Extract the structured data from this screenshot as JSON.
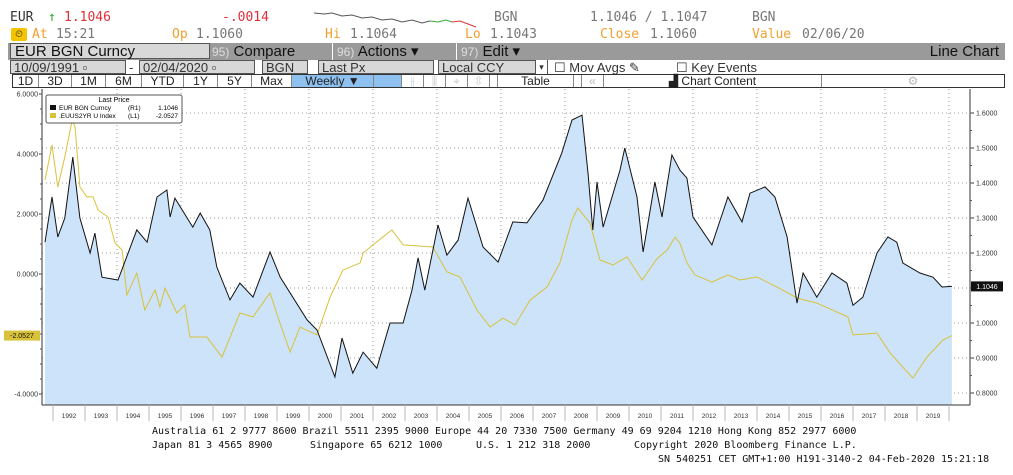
{
  "quote": {
    "ticker": "EUR",
    "arrow": "↑",
    "last": "1.1046",
    "change": "-.0014",
    "currency_left": "BGN",
    "bid_ask": "1.1046 / 1.1047",
    "currency_right": "BGN",
    "at_label": "At",
    "at_value": "15:21",
    "op_label": "Op",
    "op_value": "1.1060",
    "hi_label": "Hi",
    "hi_value": "1.1064",
    "lo_label": "Lo",
    "lo_value": "1.1043",
    "close_label": "Close",
    "close_value": "1.1060",
    "value_label": "Value",
    "value_value": "02/06/20"
  },
  "toolbar": {
    "security": "EUR BGN Curncy",
    "compare_num": "95)",
    "compare": "Compare",
    "actions_num": "96)",
    "actions": "Actions ▾",
    "edit_num": "97)",
    "edit": "Edit ▾",
    "chart_type": "Line Chart"
  },
  "settings": {
    "start_date": "10/09/1991",
    "end_date": "02/04/2020",
    "currency": "BGN",
    "field": "Last Px",
    "ccy_mode": "Local CCY",
    "mov_avgs": "Mov Avgs",
    "key_events": "Key Events"
  },
  "periods": [
    "1D",
    "3D",
    "1M",
    "6M",
    "YTD",
    "1Y",
    "5Y",
    "Max"
  ],
  "frequency": "Weekly ▼",
  "table_label": "Table",
  "chart_content_label": "Chart Content",
  "colors": {
    "black_series": "#111111",
    "yellow_series": "#d8c23a",
    "fill": "#cce3fa",
    "selected": "#8ec1f0",
    "red": "#e0303a",
    "orange": "#f0a030"
  },
  "chart_data": {
    "type": "line",
    "legend": {
      "title": "Last Price",
      "position": "top-left",
      "entries": [
        {
          "name": "EUR BGN Curncy",
          "axis": "(R1)",
          "last": "1.1046"
        },
        {
          "name": ".EUUS2YR U Index",
          "axis": "(L1)",
          "last": "-2.0527"
        }
      ]
    },
    "x_ticks": [
      "1992",
      "1993",
      "1994",
      "1995",
      "1996",
      "1997",
      "1998",
      "1999",
      "2000",
      "2001",
      "2002",
      "2003",
      "2004",
      "2005",
      "2006",
      "2007",
      "2008",
      "2009",
      "2010",
      "2011",
      "2012",
      "2013",
      "2014",
      "2015",
      "2016",
      "2017",
      "2018",
      "2019"
    ],
    "xlim": [
      1991.7,
      2020.1
    ],
    "left_axis": {
      "ylim": [
        -4.2,
        6.0
      ],
      "ticks": [
        "6.0000",
        "4.0000",
        "2.0000",
        "0.0000",
        "-4.0000"
      ],
      "tick_values": [
        6,
        4,
        2,
        0,
        -4
      ],
      "last_label": "-2.0527",
      "last_value": -2.0527
    },
    "right_axis": {
      "ylim": [
        0.77,
        1.655
      ],
      "ticks": [
        "1.6000",
        "1.5000",
        "1.4000",
        "1.3000",
        "1.2000",
        "1.0000",
        "0.9000",
        "0.8000"
      ],
      "tick_values": [
        1.6,
        1.5,
        1.4,
        1.3,
        1.2,
        1.0,
        0.9,
        0.8
      ],
      "last_label": "1.1046",
      "last_value": 1.1046
    },
    "grid": true,
    "series": [
      {
        "name": "EUR BGN Curncy",
        "axis": "right",
        "filled": true,
        "points": [
          [
            1991.75,
            1.231
          ],
          [
            1991.97,
            1.36
          ],
          [
            1992.15,
            1.246
          ],
          [
            1992.37,
            1.3
          ],
          [
            1992.62,
            1.474
          ],
          [
            1992.84,
            1.3
          ],
          [
            1993.16,
            1.2
          ],
          [
            1993.31,
            1.257
          ],
          [
            1993.53,
            1.131
          ],
          [
            1994.03,
            1.123
          ],
          [
            1994.62,
            1.266
          ],
          [
            1994.94,
            1.231
          ],
          [
            1995.25,
            1.36
          ],
          [
            1995.56,
            1.38
          ],
          [
            1995.66,
            1.303
          ],
          [
            1995.81,
            1.357
          ],
          [
            1996.37,
            1.274
          ],
          [
            1996.6,
            1.314
          ],
          [
            1996.9,
            1.266
          ],
          [
            1997.12,
            1.16
          ],
          [
            1997.53,
            1.066
          ],
          [
            1997.84,
            1.114
          ],
          [
            1998.25,
            1.074
          ],
          [
            1998.78,
            1.203
          ],
          [
            1999.1,
            1.131
          ],
          [
            1999.94,
            1.009
          ],
          [
            2000.25,
            0.98
          ],
          [
            2000.81,
            0.846
          ],
          [
            2001.03,
            0.957
          ],
          [
            2001.37,
            0.857
          ],
          [
            2001.69,
            0.917
          ],
          [
            2002.12,
            0.871
          ],
          [
            2002.53,
            1.0
          ],
          [
            2002.94,
            1.0
          ],
          [
            2003.22,
            1.094
          ],
          [
            2003.41,
            1.186
          ],
          [
            2003.62,
            1.094
          ],
          [
            2004.03,
            1.28
          ],
          [
            2004.31,
            1.194
          ],
          [
            2004.66,
            1.237
          ],
          [
            2004.97,
            1.357
          ],
          [
            2005.44,
            1.217
          ],
          [
            2005.91,
            1.174
          ],
          [
            2006.37,
            1.289
          ],
          [
            2006.81,
            1.286
          ],
          [
            2007.31,
            1.351
          ],
          [
            2007.9,
            1.486
          ],
          [
            2008.22,
            1.58
          ],
          [
            2008.53,
            1.594
          ],
          [
            2008.72,
            1.429
          ],
          [
            2008.87,
            1.266
          ],
          [
            2009.0,
            1.403
          ],
          [
            2009.19,
            1.274
          ],
          [
            2009.72,
            1.437
          ],
          [
            2009.87,
            1.5
          ],
          [
            2010.25,
            1.36
          ],
          [
            2010.44,
            1.203
          ],
          [
            2010.81,
            1.403
          ],
          [
            2011.03,
            1.303
          ],
          [
            2011.34,
            1.48
          ],
          [
            2011.59,
            1.437
          ],
          [
            2011.81,
            1.414
          ],
          [
            2012.0,
            1.303
          ],
          [
            2012.59,
            1.223
          ],
          [
            2013.09,
            1.36
          ],
          [
            2013.53,
            1.289
          ],
          [
            2013.78,
            1.371
          ],
          [
            2014.25,
            1.389
          ],
          [
            2014.56,
            1.36
          ],
          [
            2014.94,
            1.246
          ],
          [
            2015.25,
            1.057
          ],
          [
            2015.44,
            1.143
          ],
          [
            2015.87,
            1.074
          ],
          [
            2016.34,
            1.143
          ],
          [
            2016.81,
            1.114
          ],
          [
            2017.0,
            1.051
          ],
          [
            2017.31,
            1.074
          ],
          [
            2017.75,
            1.2
          ],
          [
            2018.09,
            1.246
          ],
          [
            2018.37,
            1.231
          ],
          [
            2018.56,
            1.171
          ],
          [
            2019.09,
            1.143
          ],
          [
            2019.5,
            1.131
          ],
          [
            2019.78,
            1.103
          ],
          [
            2020.09,
            1.1046
          ]
        ]
      },
      {
        "name": ".EUUS2YR U Index",
        "axis": "left",
        "filled": false,
        "points": [
          [
            1991.75,
            3.13
          ],
          [
            1991.97,
            4.3
          ],
          [
            1992.15,
            2.9
          ],
          [
            1992.37,
            3.9
          ],
          [
            1992.6,
            5.13
          ],
          [
            1992.69,
            4.9
          ],
          [
            1992.84,
            2.9
          ],
          [
            1993.06,
            2.57
          ],
          [
            1993.25,
            2.57
          ],
          [
            1993.41,
            2.13
          ],
          [
            1993.72,
            1.9
          ],
          [
            1993.94,
            1.03
          ],
          [
            1994.16,
            0.8
          ],
          [
            1994.31,
            -0.7
          ],
          [
            1994.62,
            0.03
          ],
          [
            1994.87,
            -1.2
          ],
          [
            1995.19,
            -0.53
          ],
          [
            1995.34,
            -1.1
          ],
          [
            1995.5,
            -0.47
          ],
          [
            1995.87,
            -1.3
          ],
          [
            1996.12,
            -1.03
          ],
          [
            1996.28,
            -2.1
          ],
          [
            1996.81,
            -2.1
          ],
          [
            1997.28,
            -2.77
          ],
          [
            1997.84,
            -1.3
          ],
          [
            1998.25,
            -1.43
          ],
          [
            1998.78,
            -0.63
          ],
          [
            1999.09,
            -1.63
          ],
          [
            1999.41,
            -2.6
          ],
          [
            1999.72,
            -1.77
          ],
          [
            2000.25,
            -2.03
          ],
          [
            2000.66,
            -0.77
          ],
          [
            2001.06,
            0.13
          ],
          [
            2001.6,
            0.37
          ],
          [
            2001.69,
            0.7
          ],
          [
            2002.0,
            0.97
          ],
          [
            2002.59,
            1.47
          ],
          [
            2002.94,
            0.97
          ],
          [
            2003.87,
            0.9
          ],
          [
            2004.31,
            0.07
          ],
          [
            2004.72,
            -0.1
          ],
          [
            2005.25,
            -1.2
          ],
          [
            2005.66,
            -1.77
          ],
          [
            2006.06,
            -1.47
          ],
          [
            2006.44,
            -1.7
          ],
          [
            2006.91,
            -0.87
          ],
          [
            2007.44,
            -0.43
          ],
          [
            2007.84,
            0.37
          ],
          [
            2008.22,
            1.8
          ],
          [
            2008.4,
            2.2
          ],
          [
            2008.78,
            1.7
          ],
          [
            2009.09,
            0.47
          ],
          [
            2009.5,
            0.3
          ],
          [
            2009.94,
            0.57
          ],
          [
            2010.41,
            -0.2
          ],
          [
            2010.87,
            0.5
          ],
          [
            2011.19,
            0.8
          ],
          [
            2011.44,
            1.23
          ],
          [
            2011.59,
            1.03
          ],
          [
            2011.81,
            0.37
          ],
          [
            2012.06,
            -0.03
          ],
          [
            2012.59,
            -0.27
          ],
          [
            2013.09,
            -0.03
          ],
          [
            2013.47,
            -0.2
          ],
          [
            2014.0,
            -0.1
          ],
          [
            2014.62,
            -0.43
          ],
          [
            2015.25,
            -0.8
          ],
          [
            2015.87,
            -0.97
          ],
          [
            2016.84,
            -1.43
          ],
          [
            2017.0,
            -2.03
          ],
          [
            2017.75,
            -1.97
          ],
          [
            2018.16,
            -2.63
          ],
          [
            2018.87,
            -3.47
          ],
          [
            2019.31,
            -2.77
          ],
          [
            2019.81,
            -2.2
          ],
          [
            2020.09,
            -2.0527
          ]
        ]
      }
    ]
  },
  "footer": {
    "line1": "Australia 61 2 9777 8600 Brazil 5511 2395 9000 Europe 44 20 7330 7500 Germany 49 69 9204 1210 Hong Kong 852 2977 6000",
    "line2a": "Japan 81 3 4565 8900",
    "line2b": "Singapore 65 6212 1000",
    "line2c": "U.S. 1 212 318 2000",
    "line2d": "Copyright 2020 Bloomberg Finance L.P.",
    "line3": "SN 540251 CET  GMT+1:00 H191-3140-2 04-Feb-2020 15:21:18"
  }
}
